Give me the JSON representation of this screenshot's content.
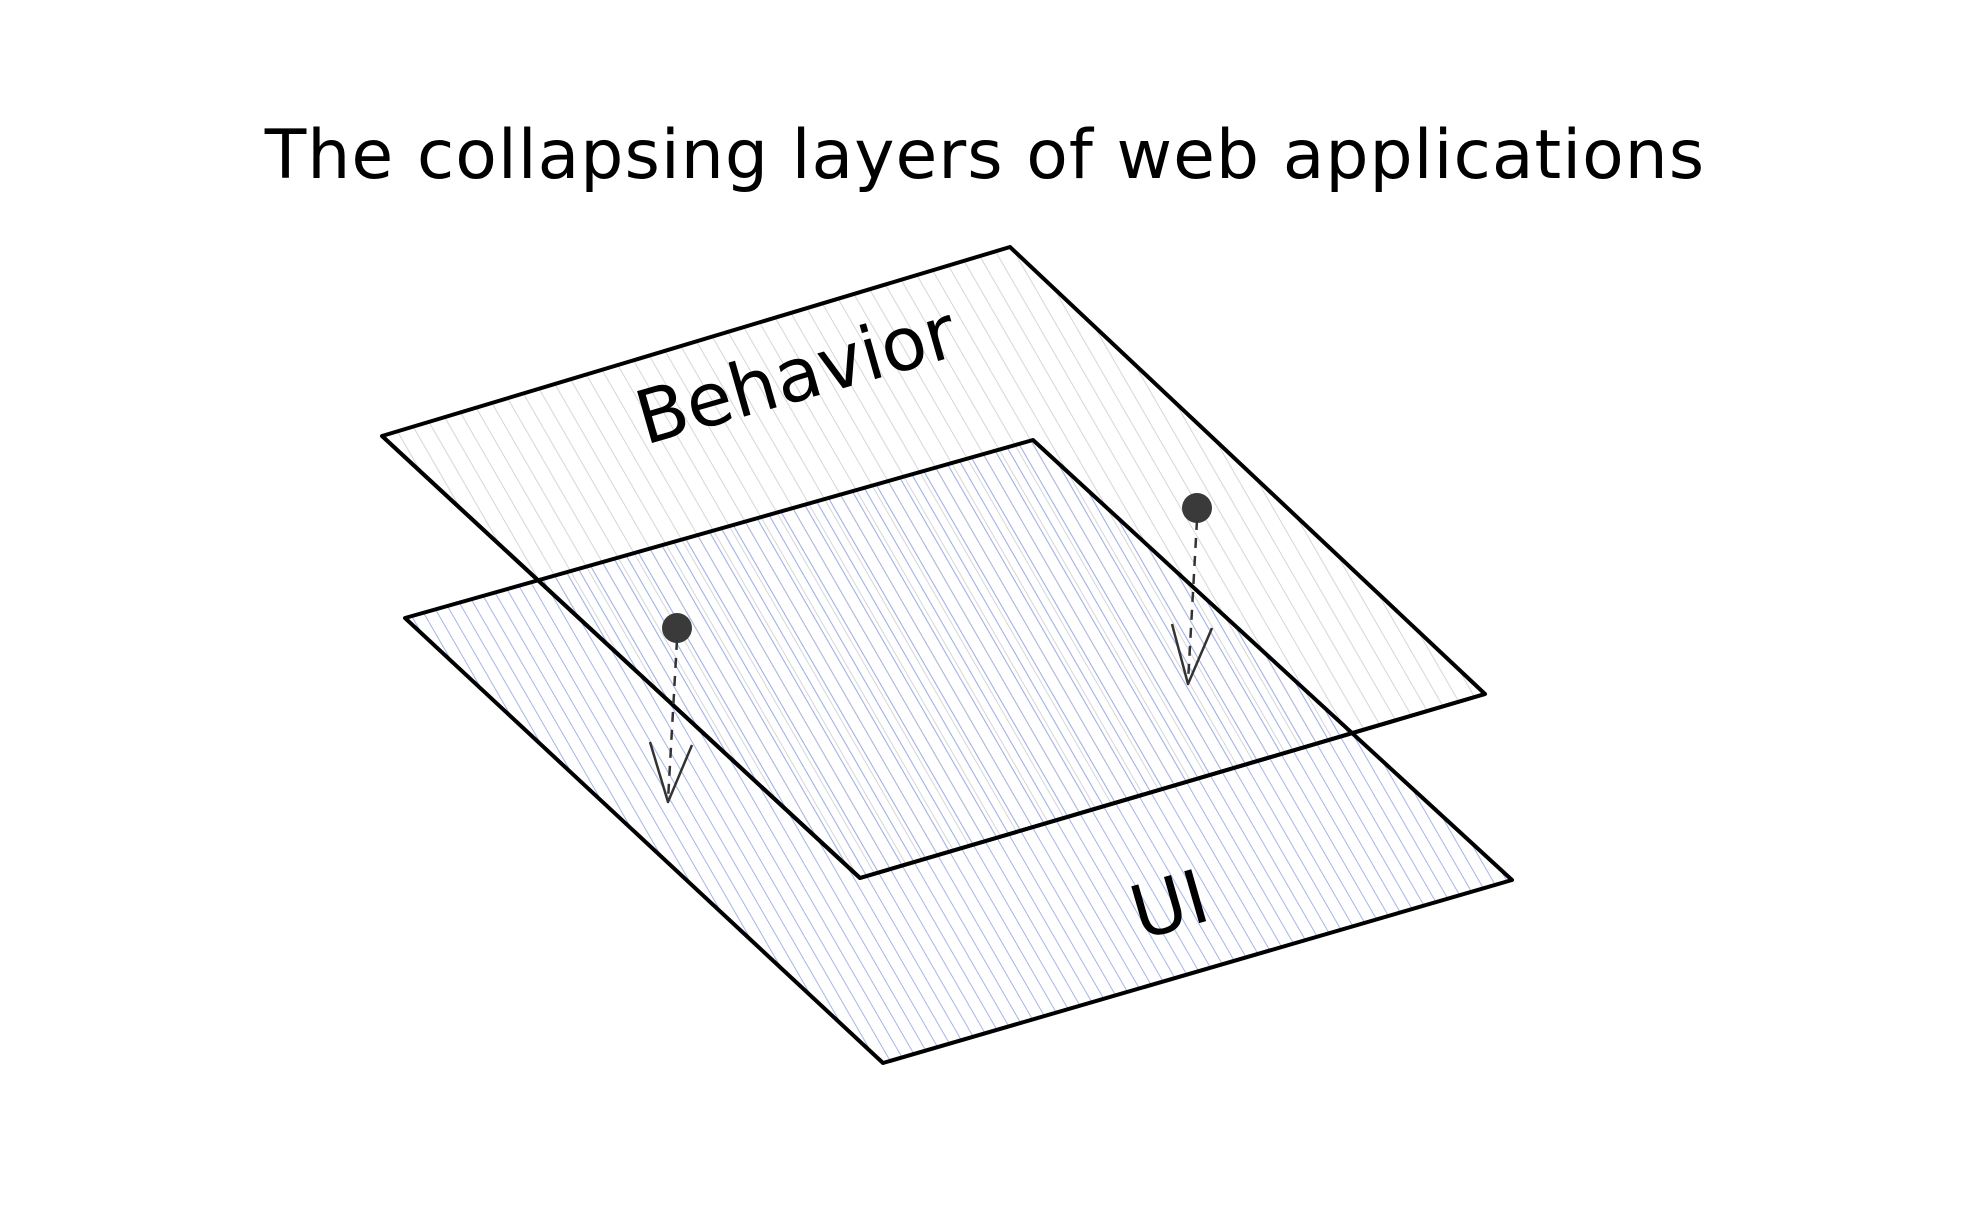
{
  "diagram": {
    "title": "The collapsing layers of web applications",
    "layers": [
      {
        "id": "behavior",
        "label": "Behavior",
        "hatch_color": "#cfcfcf"
      },
      {
        "id": "ui",
        "label": "UI",
        "hatch_color": "#9aaee8"
      }
    ],
    "colors": {
      "outline": "#000000",
      "text": "#000000",
      "marker": "#3a3a3a",
      "arrow": "#333333"
    }
  }
}
